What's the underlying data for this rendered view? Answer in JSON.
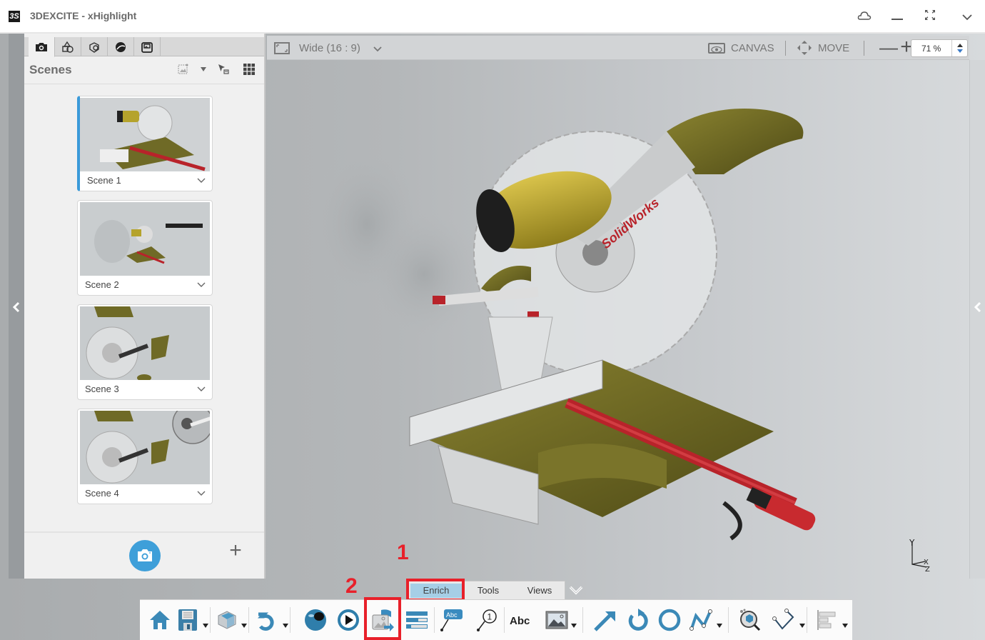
{
  "app": {
    "title": "3DEXCITE - xHighlight",
    "logo_glyph": "3S"
  },
  "window_controls": [
    {
      "name": "cloud-icon",
      "glyph": "☁"
    },
    {
      "name": "minimize-icon",
      "glyph": "—"
    },
    {
      "name": "fullscreen-icon",
      "glyph": "⤢"
    },
    {
      "name": "chevron-down-icon",
      "glyph": "⌄"
    }
  ],
  "side_panel": {
    "tabs": [
      {
        "name": "tab-scenes",
        "icon": "camera-icon",
        "active": true
      },
      {
        "name": "tab-shapes",
        "icon": "shapes-icon",
        "active": false
      },
      {
        "name": "tab-materials",
        "icon": "material-icon",
        "active": false
      },
      {
        "name": "tab-environment",
        "icon": "sphere-icon",
        "active": false
      },
      {
        "name": "tab-render",
        "icon": "render-icon",
        "active": false
      }
    ],
    "title": "Scenes",
    "header_icons": [
      "image-options-icon",
      "dropdown-arrow-icon",
      "select-scene-icon",
      "grid-view-icon"
    ],
    "scenes": [
      {
        "label": "Scene 1",
        "active": true
      },
      {
        "label": "Scene 2",
        "active": false
      },
      {
        "label": "Scene 3",
        "active": false
      },
      {
        "label": "Scene 4",
        "active": false
      }
    ],
    "footer": {
      "capture_label": "capture-scene",
      "add_label": "+"
    }
  },
  "viewport_toolbar": {
    "aspect_label": "Wide (16 : 9)",
    "canvas_label": "CANVAS",
    "move_label": "MOVE",
    "zoom_out": "—",
    "zoom_in": "+",
    "zoom_value": "71 %"
  },
  "viewport": {
    "model_brand_text": "SolidWorks",
    "axis": {
      "y": "Y",
      "x": "X",
      "z": "Z"
    }
  },
  "annotations": [
    {
      "number": "1",
      "target": "Enrich tab"
    },
    {
      "number": "2",
      "target": "Export image tool"
    }
  ],
  "bottom_tabs": [
    {
      "label": "Enrich",
      "active": true
    },
    {
      "label": "Tools",
      "active": false
    },
    {
      "label": "Views",
      "active": false
    }
  ],
  "toolbar": {
    "tools": [
      {
        "name": "home-tool",
        "icon": "home-icon"
      },
      {
        "name": "save-tool",
        "icon": "save-icon",
        "dropdown": true
      },
      {
        "name": "product-tool",
        "icon": "product-cube-icon",
        "dropdown": true
      },
      {
        "name": "undo-tool",
        "icon": "undo-icon",
        "dropdown": true
      },
      {
        "name": "environment-tool",
        "icon": "environment-sphere-icon"
      },
      {
        "name": "play-tool",
        "icon": "play-icon"
      },
      {
        "name": "export-image-tool",
        "icon": "export-image-icon"
      },
      {
        "name": "layers-tool",
        "icon": "layers-list-icon"
      },
      {
        "name": "callout-tool",
        "icon": "text-callout-icon",
        "label": "Abc"
      },
      {
        "name": "numbered-callout-tool",
        "icon": "numbered-callout-icon",
        "label": "1"
      },
      {
        "name": "text-tool",
        "icon": "text-icon",
        "label": "Abc"
      },
      {
        "name": "image-tool",
        "icon": "image-icon",
        "dropdown": true
      },
      {
        "name": "arrow-tool",
        "icon": "arrow-icon"
      },
      {
        "name": "rotate-arrow-tool",
        "icon": "rotate-arrow-icon"
      },
      {
        "name": "circle-tool",
        "icon": "circle-icon"
      },
      {
        "name": "polyline-tool",
        "icon": "polyline-icon",
        "dropdown": true
      },
      {
        "name": "magnifier-tool",
        "icon": "magnifier-icon"
      },
      {
        "name": "measure-tool",
        "icon": "measure-icon",
        "dropdown": true
      },
      {
        "name": "align-tool",
        "icon": "align-icon",
        "dropdown": true
      }
    ]
  },
  "colors": {
    "accent": "#3e9fd9",
    "annotation_red": "#e8202a",
    "active_tab": "#a6cfe6",
    "model_olive": "#6b6420",
    "model_red": "#b8232a"
  }
}
